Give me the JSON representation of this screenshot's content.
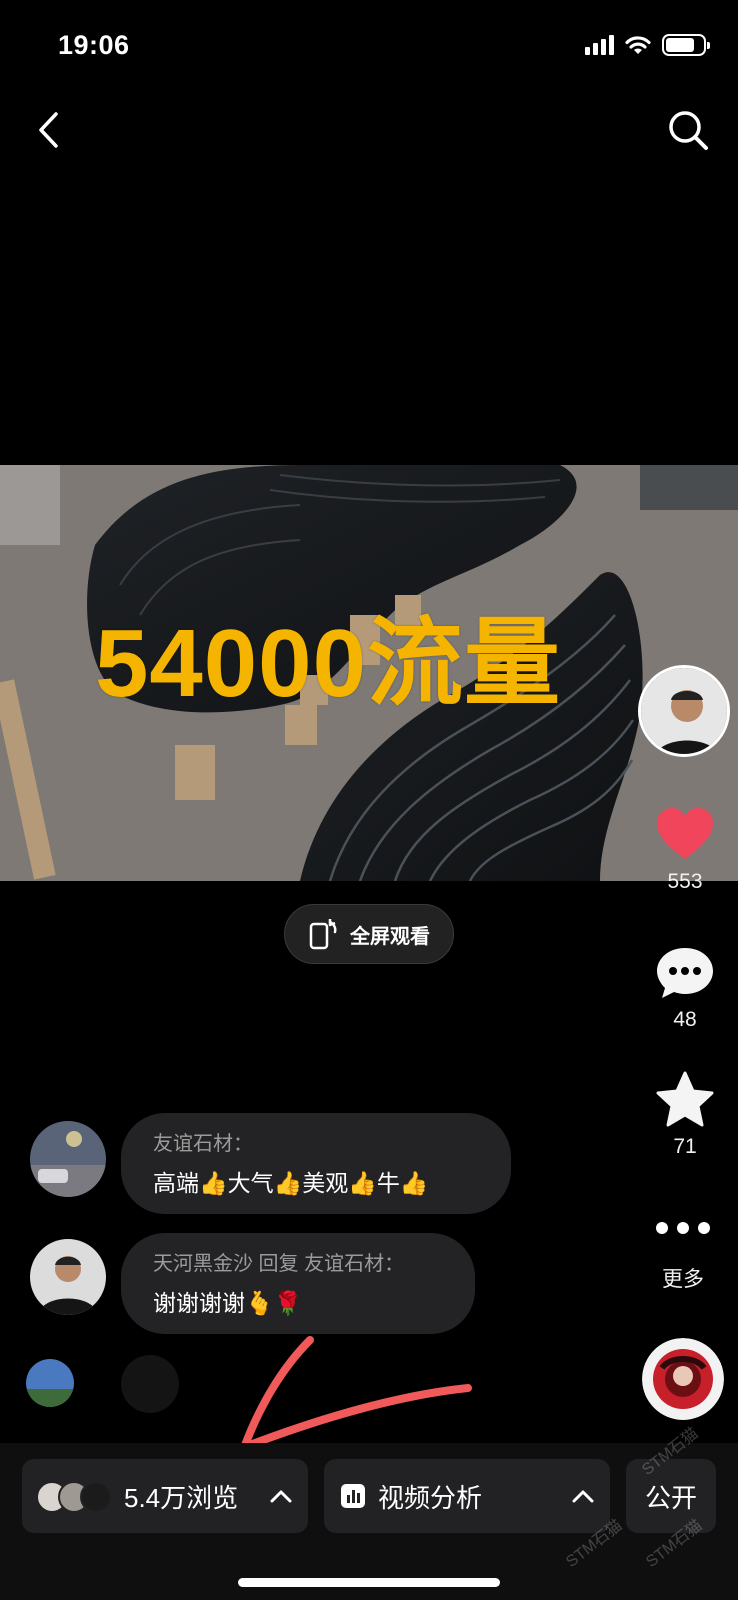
{
  "status_bar": {
    "time": "19:06"
  },
  "video": {
    "overlay_text": "54000流量"
  },
  "actions": {
    "likes": "553",
    "comments": "48",
    "favorites": "71",
    "more_label": "更多"
  },
  "fullscreen": {
    "label": "全屏观看"
  },
  "comments": [
    {
      "author": "友谊石材：",
      "text": "高端👍大气👍美观👍牛👍"
    },
    {
      "author": "天河黑金沙 回复 友谊石材：",
      "text": "谢谢谢谢🫰🌹"
    }
  ],
  "bottom_bar": {
    "views_label": "5.4万浏览",
    "analysis_label": "视频分析",
    "visibility_label": "公开"
  },
  "watermark": {
    "text": "STM石猫"
  },
  "colors": {
    "accent_red": "#f0455a",
    "overlay_yellow": "#f5b400",
    "annotation_arrow": "#f05a5a"
  }
}
